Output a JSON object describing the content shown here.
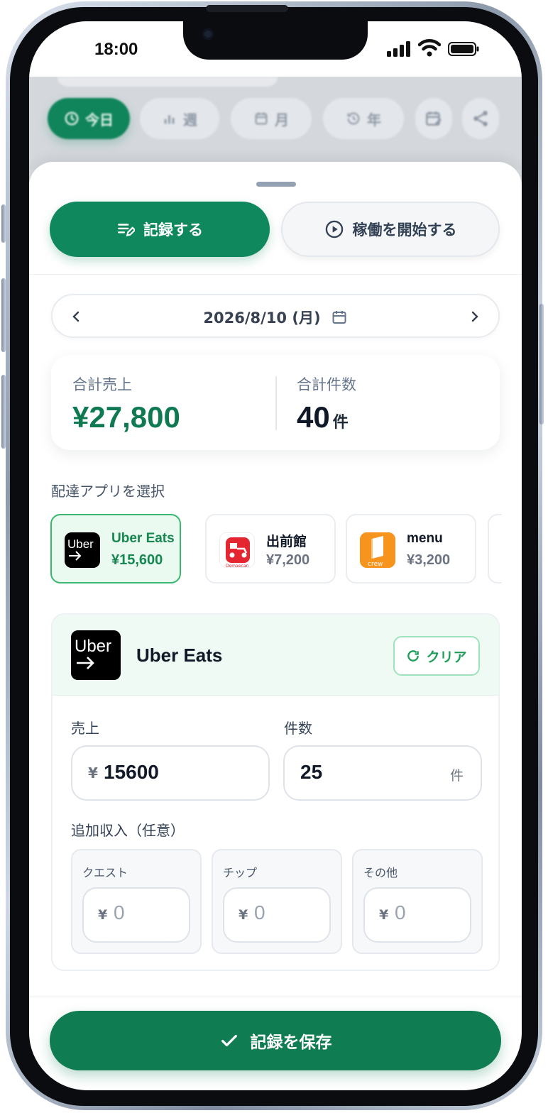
{
  "status_bar": {
    "time": "18:00"
  },
  "top_tabs": [
    {
      "label": "今日",
      "icon": "clock-icon",
      "active": true
    },
    {
      "label": "週",
      "icon": "bar-chart-icon",
      "active": false
    },
    {
      "label": "月",
      "icon": "calendar-icon",
      "active": false
    },
    {
      "label": "年",
      "icon": "history-icon",
      "active": false
    }
  ],
  "actions": {
    "record_label": "記録する",
    "start_work_label": "稼働を開始する"
  },
  "date_nav": {
    "date": "2026/8/10 (月)"
  },
  "summary": {
    "sales_label": "合計売上",
    "sales_value": "¥27,800",
    "count_label": "合計件数",
    "count_value": "40",
    "count_unit": "件"
  },
  "app_select": {
    "label": "配達アプリを選択",
    "apps": [
      {
        "name": "Uber Eats",
        "amount": "¥15,600",
        "selected": true,
        "logo_text": "Uber"
      },
      {
        "name": "出前館",
        "amount": "¥7,200",
        "selected": false,
        "logo_text": "Demaecan"
      },
      {
        "name": "menu",
        "amount": "¥3,200",
        "selected": false,
        "logo_text": "crew"
      }
    ]
  },
  "detail": {
    "app_name": "Uber Eats",
    "logo_text": "Uber",
    "clear_label": "クリア",
    "sales_label": "売上",
    "sales_prefix": "¥",
    "sales_value": "15600",
    "count_label": "件数",
    "count_value": "25",
    "count_suffix": "件",
    "extra_label": "追加収入（任意）",
    "extras": [
      {
        "label": "クエスト",
        "prefix": "¥",
        "value": "0"
      },
      {
        "label": "チップ",
        "prefix": "¥",
        "value": "0"
      },
      {
        "label": "その他",
        "prefix": "¥",
        "value": "0"
      }
    ]
  },
  "save_label": "記録を保存",
  "colors": {
    "primary": "#10885d",
    "primary_dark": "#0f7c52",
    "selected_bg": "#eafaf1",
    "selected_border": "#38b76f"
  }
}
